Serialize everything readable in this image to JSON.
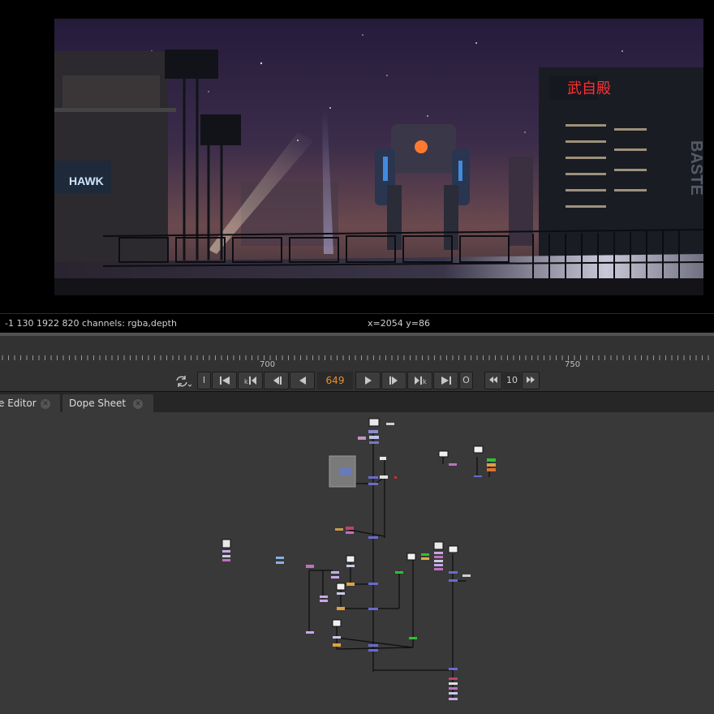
{
  "viewer": {
    "info_left": "-1 130 1922 820 channels: rgba,depth",
    "info_coords": "x=2054 y=86",
    "sign_red": "武自殿",
    "sign_left": "HAWK",
    "sign_right": "BASTE"
  },
  "timeline": {
    "ticks": [
      "700",
      "750"
    ],
    "current_frame": "649",
    "increment": "10",
    "in_label": "I",
    "out_label": "O"
  },
  "tabs": [
    {
      "label": "e Editor"
    },
    {
      "label": "Dope Sheet"
    }
  ],
  "icons": {
    "loop": "loop-mode-icon",
    "first": "first-frame-icon",
    "prev_key": "previous-keyframe-icon",
    "step_back": "step-back-icon",
    "play_back": "play-backward-icon",
    "play_fwd": "play-forward-icon",
    "step_fwd": "step-forward-icon",
    "next_key": "next-keyframe-icon",
    "last": "last-frame-icon",
    "dec": "decrement-icon",
    "inc": "increment-icon",
    "close": "close-icon"
  },
  "colors": {
    "frame_accent": "#e8902a",
    "graph_bg": "#393939",
    "timeline_bg": "#323232"
  }
}
